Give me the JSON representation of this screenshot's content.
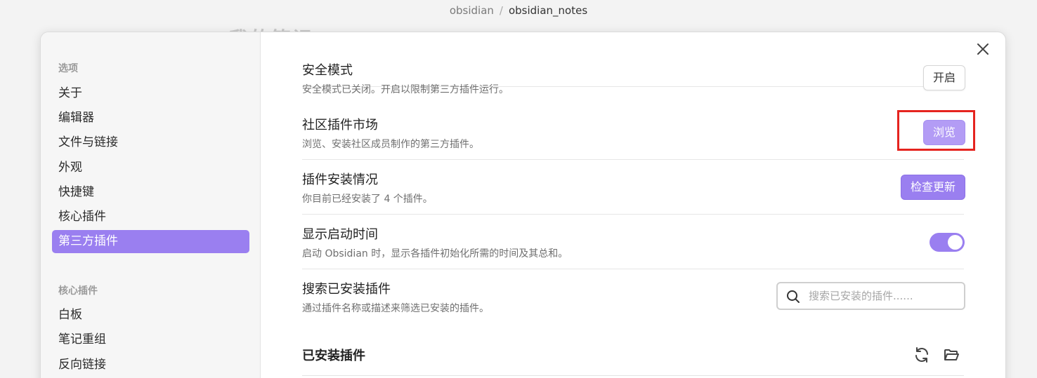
{
  "breadcrumb": {
    "parent": "obsidian",
    "separator": "/",
    "current": "obsidian_notes"
  },
  "ghost_title": "我的笔记",
  "sidebar": {
    "groups": [
      {
        "title": "选项",
        "items": [
          "关于",
          "编辑器",
          "文件与链接",
          "外观",
          "快捷键",
          "核心插件",
          "第三方插件"
        ]
      },
      {
        "title": "核心插件",
        "items": [
          "白板",
          "笔记重组",
          "反向链接"
        ]
      }
    ],
    "active_item": "第三方插件"
  },
  "settings": [
    {
      "name": "安全模式",
      "desc": "安全模式已关闭。开启以限制第三方插件运行。",
      "control_label": "开启"
    },
    {
      "name": "社区插件市场",
      "desc": "浏览、安装社区成员制作的第三方插件。",
      "control_label": "浏览"
    },
    {
      "name": "插件安装情况",
      "desc": "你目前已经安装了 4 个插件。",
      "control_label": "检查更新"
    },
    {
      "name": "显示启动时间",
      "desc": "启动 Obsidian 时，显示各插件初始化所需的时间及其总和。",
      "toggle_on": true
    },
    {
      "name": "搜索已安装插件",
      "desc": "通过插件名称或描述来筛选已安装的插件。",
      "search_placeholder": "搜索已安装的插件......",
      "search_value": ""
    }
  ],
  "installed_section": {
    "title": "已安装插件"
  },
  "icons": {
    "close": "close-icon",
    "search": "search-icon",
    "reload": "reload-icon",
    "folder": "folder-open-icon"
  },
  "colors": {
    "accent": "#9a7ff0",
    "accent_light": "#b39cf5",
    "highlight": "#e5241f"
  }
}
